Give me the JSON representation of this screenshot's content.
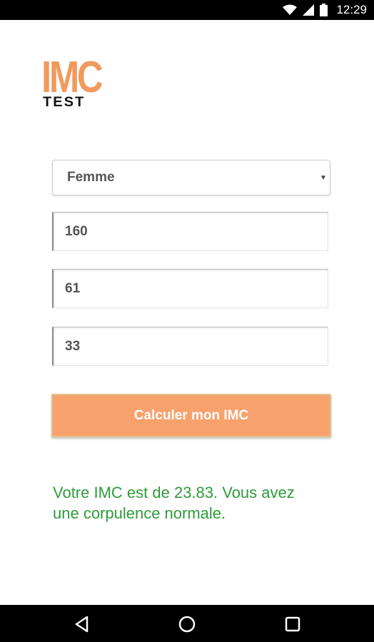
{
  "status_bar": {
    "time": "12:29",
    "icons": [
      "wifi-icon",
      "signal-icon",
      "battery-icon"
    ]
  },
  "logo": {
    "title": "IMC",
    "subtitle": "TEST",
    "title_color": "#f19a5e"
  },
  "form": {
    "gender": {
      "selected": "Femme"
    },
    "height": {
      "value": "160"
    },
    "weight": {
      "value": "61"
    },
    "age": {
      "value": "33"
    },
    "submit_label": "Calculer mon IMC",
    "button_color": "#f7a26c"
  },
  "result": {
    "text": "Votre IMC est de 23.83. Vous avez une corpulence normale.",
    "color": "#2e9b3a"
  },
  "nav_bar": {
    "buttons": [
      "back-icon",
      "home-icon",
      "recent-apps-icon"
    ]
  }
}
